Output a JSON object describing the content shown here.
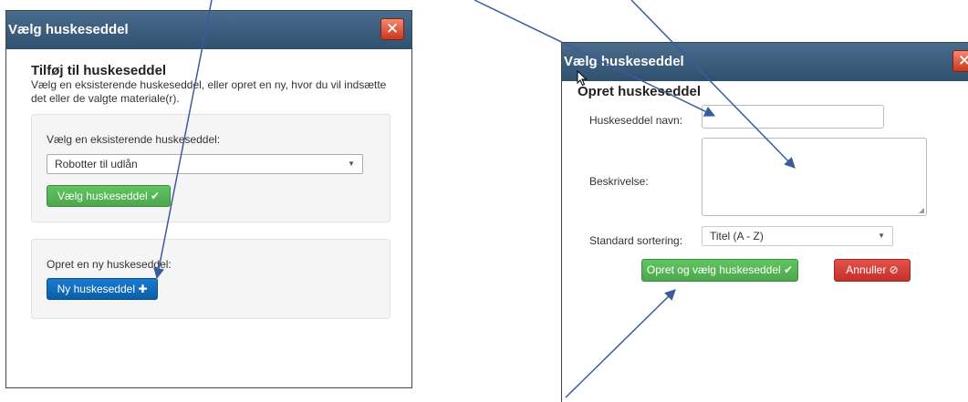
{
  "left_dialog": {
    "title": "Vælg huskeseddel",
    "close_glyph": "✕",
    "heading": "Tilføj til huskeseddel",
    "description": "Vælg en eksisterende huskeseddel, eller opret en ny, hvor du vil indsætte det eller de valgte materiale(r).",
    "existing_label": "Vælg en eksisterende huskeseddel:",
    "existing_selected": "Robotter til udlån",
    "choose_button": "Vælg huskeseddel ✔",
    "new_label": "Opret en ny huskeseddel:",
    "new_button": "Ny huskeseddel ✚"
  },
  "right_dialog": {
    "title": "Vælg huskeseddel",
    "close_glyph": "✕",
    "heading": "Opret huskeseddel",
    "name_label": "Huskeseddel navn:",
    "name_value": "",
    "description_label": "Beskrivelse:",
    "description_value": "",
    "sort_label": "Standard sortering:",
    "sort_selected": "Titel (A - Z)",
    "create_button": "Opret og vælg huskeseddel ✔",
    "cancel_button": "Annuller ⊘"
  },
  "icons": {
    "close": "close-icon",
    "checkmark": "checkmark-icon",
    "plus": "plus-icon",
    "cancel": "cancel-circle-icon",
    "dropdown": "chevron-down-icon",
    "cursor": "mouse-cursor-icon"
  },
  "colors": {
    "titlebar": "#30506f",
    "close": "#c8381e",
    "success": "#5cb85c",
    "primary": "#0a5fa6",
    "danger": "#d9534f",
    "annotation_arrow": "#3a5ba0"
  }
}
